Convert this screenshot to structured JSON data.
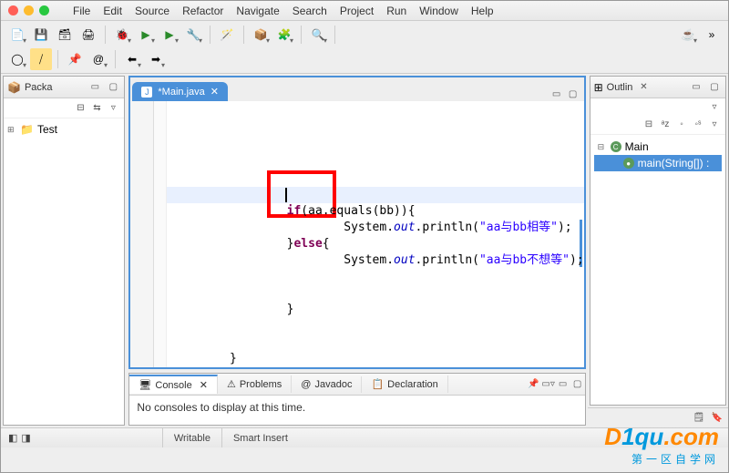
{
  "menu": [
    "File",
    "Edit",
    "Source",
    "Refactor",
    "Navigate",
    "Search",
    "Project",
    "Run",
    "Window",
    "Help"
  ],
  "toolbar_row1": [
    {
      "name": "new-icon",
      "glyph": "📄",
      "dd": true
    },
    {
      "name": "save-icon",
      "glyph": "💾"
    },
    {
      "name": "save-all-icon",
      "glyph": "🗃"
    },
    {
      "name": "print-icon",
      "glyph": "🖨"
    },
    {
      "name": "sep"
    },
    {
      "name": "debug-icon",
      "glyph": "🐞",
      "dd": true
    },
    {
      "name": "run-icon",
      "glyph": "▶",
      "dd": true,
      "color": "#2a8a2a"
    },
    {
      "name": "run-config-icon",
      "glyph": "▶",
      "dd": true,
      "color": "#2a8a2a"
    },
    {
      "name": "external-tools-icon",
      "glyph": "🔧",
      "dd": true
    },
    {
      "name": "sep"
    },
    {
      "name": "wand-icon",
      "glyph": "🪄"
    },
    {
      "name": "sep"
    },
    {
      "name": "new-package-icon",
      "glyph": "📦",
      "dd": true
    },
    {
      "name": "new-class-icon",
      "glyph": "🧩",
      "dd": true
    },
    {
      "name": "sep"
    },
    {
      "name": "search-icon",
      "glyph": "🔍",
      "dd": true
    },
    {
      "name": "sep2"
    }
  ],
  "toolbar_right": {
    "perspective": "☕",
    "dd": true,
    "kebab": "»"
  },
  "toolbar_row2": [
    {
      "name": "breakpoint-icon",
      "glyph": "◯",
      "dd": true
    },
    {
      "name": "skip-breakpoints-icon",
      "glyph": "⧸",
      "hl": true
    },
    {
      "name": "sep"
    },
    {
      "name": "pin-icon",
      "glyph": "📌"
    },
    {
      "name": "annotation-icon",
      "glyph": "@",
      "dd": true
    },
    {
      "name": "sep"
    },
    {
      "name": "back-icon",
      "glyph": "⬅",
      "dd": true
    },
    {
      "name": "forward-icon",
      "glyph": "➡",
      "dd": true
    }
  ],
  "package_explorer": {
    "title": "Packa",
    "close": "✕",
    "toolbar": [
      {
        "n": "collapse-icon",
        "g": "⊟"
      },
      {
        "n": "link-icon",
        "g": "⇆"
      },
      {
        "n": "menu-icon",
        "g": "▿"
      }
    ],
    "items": [
      {
        "label": "Test",
        "icon": "📁",
        "expander": "⊞"
      }
    ]
  },
  "editor": {
    "tab_icon": "J",
    "tab_label": "*Main.java",
    "tab_close": "✕",
    "right_btns": [
      {
        "n": "minimize-icon",
        "g": "▭"
      },
      {
        "n": "maximize-icon",
        "g": "▢"
      }
    ],
    "code_lines": [
      {
        "indent": 4,
        "segs": [
          {
            "t": "if",
            "c": "kw"
          },
          {
            "t": "(aa.equals(bb)){"
          }
        ]
      },
      {
        "indent": 6,
        "segs": [
          {
            "t": "System."
          },
          {
            "t": "out",
            "c": "it"
          },
          {
            "t": ".println("
          },
          {
            "t": "\"aa与bb相等\"",
            "c": "str"
          },
          {
            "t": ");"
          }
        ]
      },
      {
        "indent": 4,
        "segs": [
          {
            "t": "}"
          },
          {
            "t": "else",
            "c": "kw"
          },
          {
            "t": "{"
          }
        ]
      },
      {
        "indent": 6,
        "segs": [
          {
            "t": "System."
          },
          {
            "t": "out",
            "c": "it"
          },
          {
            "t": ".println("
          },
          {
            "t": "\"aa与bb不想等\"",
            "c": "str"
          },
          {
            "t": ");"
          }
        ]
      },
      {
        "indent": 6,
        "segs": [
          {
            "t": ""
          }
        ]
      },
      {
        "indent": 6,
        "segs": [
          {
            "t": ""
          }
        ]
      },
      {
        "indent": 4,
        "segs": [
          {
            "t": "}"
          }
        ]
      },
      {
        "indent": 4,
        "segs": [
          {
            "t": ""
          }
        ]
      },
      {
        "indent": 4,
        "segs": [
          {
            "t": ""
          }
        ]
      },
      {
        "indent": 2,
        "segs": [
          {
            "t": "}"
          }
        ]
      }
    ]
  },
  "console": {
    "tabs": [
      {
        "label": "Console",
        "icon": "🖥",
        "active": true,
        "close": "✕"
      },
      {
        "label": "Problems",
        "icon": "⚠"
      },
      {
        "label": "Javadoc",
        "icon": "@"
      },
      {
        "label": "Declaration",
        "icon": "📋"
      }
    ],
    "right_btns": [
      {
        "n": "pin-console-icon",
        "g": "📌"
      },
      {
        "n": "console-menu-icon",
        "g": "▭▿"
      },
      {
        "n": "minimize-icon",
        "g": "▭"
      },
      {
        "n": "maximize-icon",
        "g": "▢"
      }
    ],
    "message": "No consoles to display at this time."
  },
  "outline": {
    "title": "Outlin",
    "close": "✕",
    "toolbar": [
      {
        "n": "sort-icon",
        "g": "⊟"
      },
      {
        "n": "az-icon",
        "g": "ᵃz"
      },
      {
        "n": "hide-fields-icon",
        "g": "◦"
      },
      {
        "n": "hide-static-icon",
        "g": "◦ˢ"
      },
      {
        "n": "menu-icon",
        "g": "▿"
      }
    ],
    "items": [
      {
        "label": "Main",
        "icon": "C",
        "cls": "cls",
        "indent": 0,
        "exp": "⊟"
      },
      {
        "label": "main(String[]) :",
        "icon": "●",
        "cls": "mth",
        "indent": 1,
        "sel": true
      }
    ],
    "mini_right": [
      {
        "n": "task-icon",
        "g": "🗒"
      },
      {
        "n": "bookmark-icon",
        "g": "🔖"
      }
    ]
  },
  "statusbar": {
    "left_icons": [
      "◧",
      "◨"
    ],
    "writable": "Writable",
    "insert": "Smart Insert"
  },
  "watermark": {
    "line1_a": "D",
    "line1_b": "1",
    "line1_c": "qu",
    "line1_d": ".com",
    "line2": "第一区自学网"
  }
}
